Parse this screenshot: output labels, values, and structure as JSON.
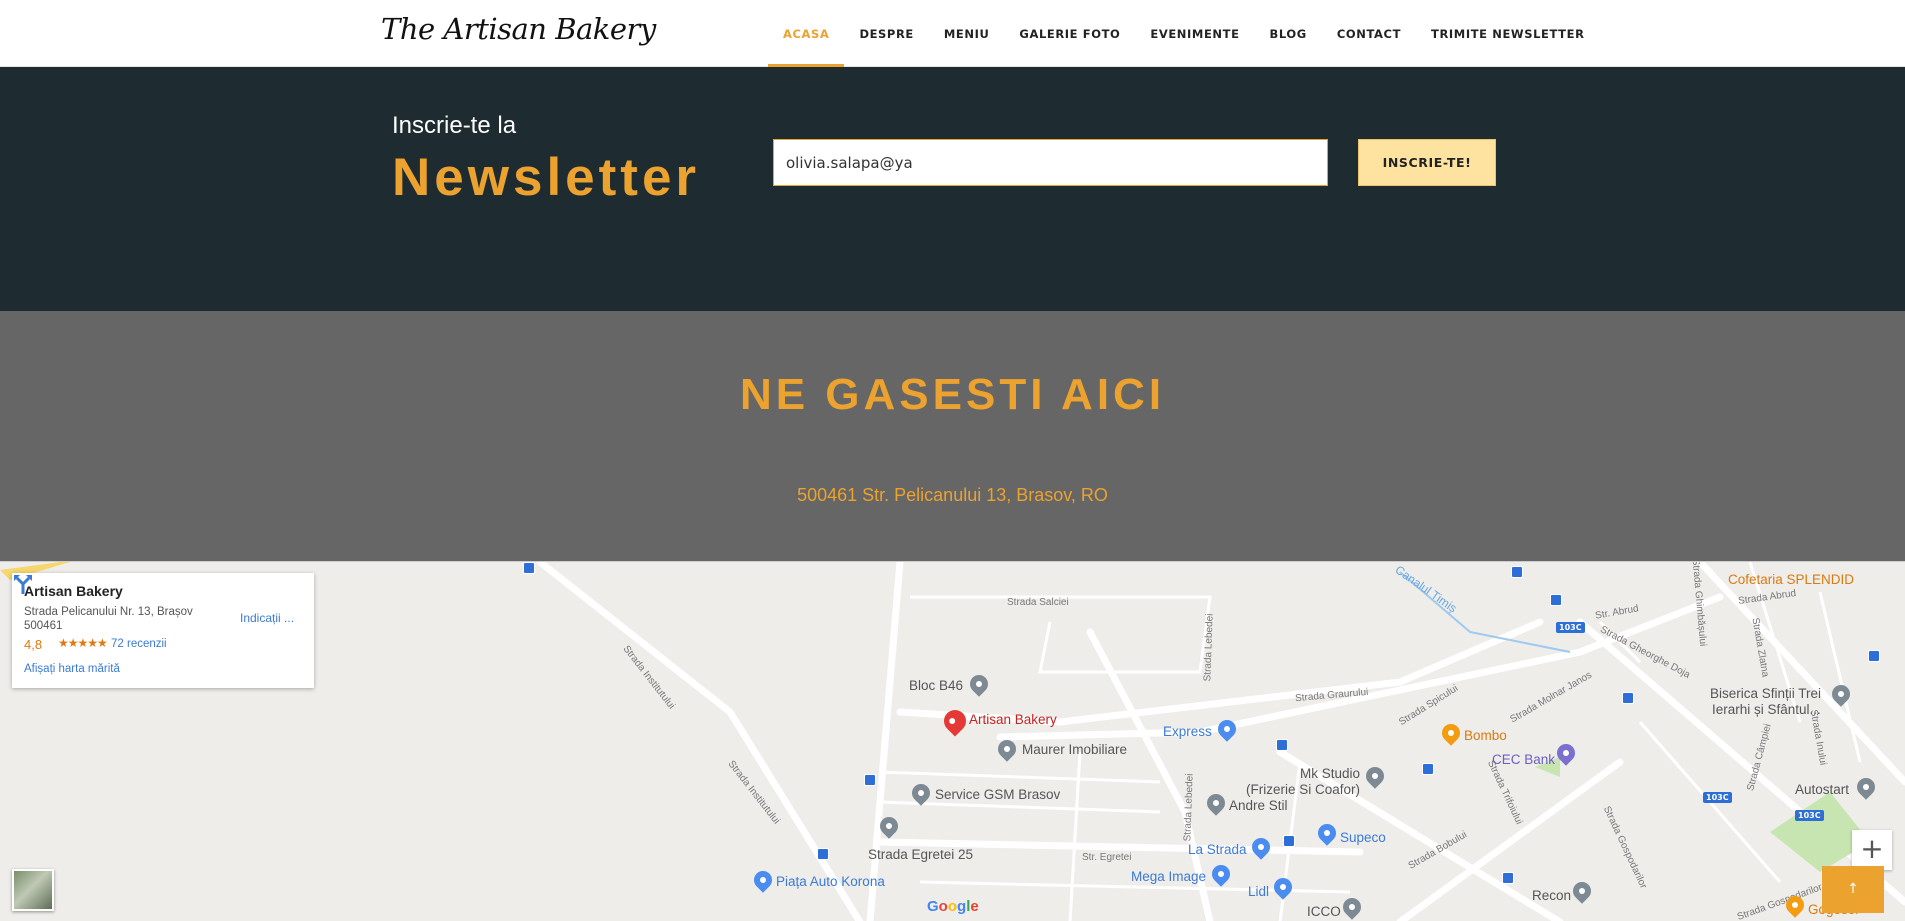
{
  "nav": {
    "logo": "The Artisan Bakery",
    "items": [
      {
        "label": "ACASA",
        "active": true
      },
      {
        "label": "DESPRE"
      },
      {
        "label": "MENIU"
      },
      {
        "label": "GALERIE FOTO"
      },
      {
        "label": "EVENIMENTE"
      },
      {
        "label": "BLOG"
      },
      {
        "label": "CONTACT"
      },
      {
        "label": "TRIMITE NEWSLETTER"
      }
    ]
  },
  "newsletter": {
    "small_title": "Inscrie-te la",
    "big_title": "Newsletter",
    "email_value": "olivia.salapa@ya",
    "button_label": "INSCRIE-TE!"
  },
  "findus": {
    "title": "NE GASESTI AICI",
    "address": "500461 Str. Pelicanului 13, Brasov, RO"
  },
  "map": {
    "card": {
      "name": "Artisan Bakery",
      "address": "Strada Pelicanului Nr. 13, Brașov 500461",
      "rating": "4,8",
      "stars": "★★★★★",
      "reviews": "72 recenzii",
      "larger_map": "Afișați harta mărită",
      "directions": "Indicații ..."
    },
    "places": {
      "bakery": "Artisan Bakery",
      "bloc": "Bloc B46",
      "maurer": "Maurer Imobiliare",
      "service": "Service GSM Brasov",
      "egretei": "Strada Egretei 25",
      "piata": "Piața Auto Korona",
      "express": "Express",
      "mkstudio": "Mk Studio",
      "frizerie": "(Frizerie Si Coafor)",
      "andre": "Andre Stil",
      "lastrada": "La Strada",
      "mega": "Mega Image",
      "lidl": "Lidl",
      "icco": "ICCO",
      "supeco": "Supeco",
      "bombo": "Bombo",
      "cec": "CEC Bank",
      "splendid": "Cofetaria SPLENDID",
      "biserica1": "Biserica Sfinții Trei",
      "biserica2": "Ierarhi și Sfântul...",
      "autostart": "Autostart",
      "recon": "Recon",
      "gogosel": "Gogosel"
    },
    "streets": {
      "salciei": "Strada Salciei",
      "institutului1": "Strada Institutului",
      "institutului2": "Strada Institutului",
      "lebedei1": "Strada Lebedei",
      "lebedei2": "Strada Lebedei",
      "graurului": "Strada Graurului",
      "spicului": "Strada Spicului",
      "molnar": "Strada Molnar Janos",
      "egretei": "Str. Egretei",
      "bobului": "Strada Bobului",
      "trifoiului": "Strada Trifoiului",
      "gospodarilor": "Strada Gospodarilor",
      "gospodarilor2": "Strada Gospodarilor",
      "abrud1": "Str. Abrud",
      "abrud2": "Strada Abrud",
      "doja": "Strada Gheorghe Doja",
      "zlatna": "Strada Zlatna",
      "campiei": "Strada Câmpiei",
      "inului": "Strada Inului",
      "canal": "Canalul Timiș",
      "ghimbasului": "Strada Ghimbășului"
    },
    "routes": {
      "r1": "103C",
      "r2": "103C",
      "r3": "103C"
    },
    "zoom_label": "+",
    "google_letters": [
      "G",
      "o",
      "o",
      "g",
      "l",
      "e"
    ]
  },
  "totop": "↑"
}
